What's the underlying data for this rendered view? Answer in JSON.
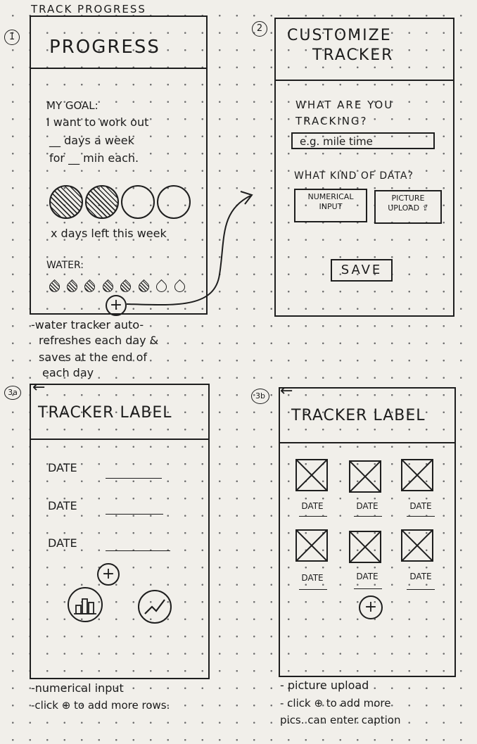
{
  "page_title": "TRACK PROGRESS",
  "screen1": {
    "number": "1",
    "title": "PROGRESS",
    "goal_lines": [
      "MY GOAL:",
      "I want to work out",
      "__ days a week",
      "for __ min each."
    ],
    "days_left": "x  days left this week",
    "water_label": "WATER:",
    "plus": "+",
    "note": [
      "-water tracker auto-",
      "refreshes each day &",
      "saves at the end of",
      "each day"
    ]
  },
  "screen2": {
    "number": "2",
    "title_lines": [
      "CUSTOMIZE",
      "TRACKER"
    ],
    "question1_lines": [
      "WHAT ARE YOU",
      "TRACKING?"
    ],
    "input_placeholder": "e.g. mile time",
    "question2": "WHAT KIND OF DATA?",
    "option1_lines": [
      "NUMERICAL",
      "INPUT"
    ],
    "option2_lines": [
      "PICTURE",
      "UPLOAD ⇪"
    ],
    "save": "SAVE"
  },
  "screen3a": {
    "number": "3a",
    "back": "←",
    "title": "TRACKER LABEL",
    "row_label": "DATE",
    "plus": "+",
    "note": [
      "-numerical input",
      "-click ⊕ to add more rows."
    ]
  },
  "screen3b": {
    "number": "3b",
    "back": "←",
    "title": "TRACKER LABEL",
    "caption": "DATE",
    "plus": "+",
    "note": [
      "- picture upload",
      "- click ⊕ to add more",
      "pics. can enter caption"
    ]
  }
}
